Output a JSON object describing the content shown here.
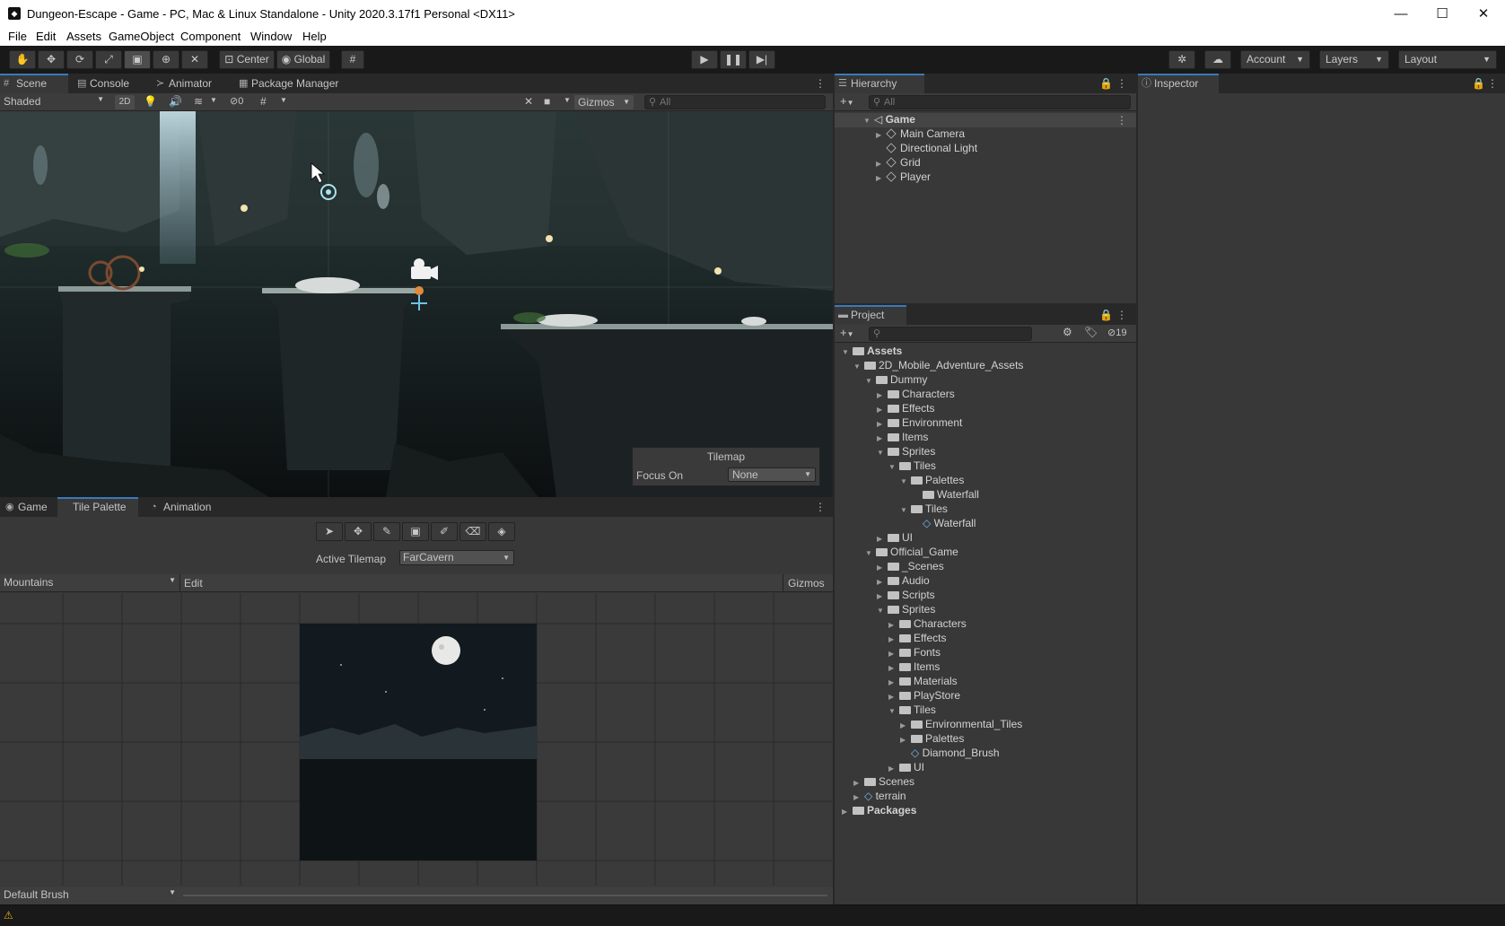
{
  "window": {
    "title": "Dungeon-Escape - Game - PC, Mac & Linux Standalone - Unity 2020.3.17f1 Personal <DX11>",
    "minimize": "—",
    "maximize": "☐",
    "close": "✕"
  },
  "menu": [
    "File",
    "Edit",
    "Assets",
    "GameObject",
    "Component",
    "Window",
    "Help"
  ],
  "toolbar": {
    "center_label": "Center",
    "global_label": "Global",
    "account_label": "Account",
    "layers_label": "Layers",
    "layout_label": "Layout"
  },
  "scene_panel": {
    "tabs": [
      "Scene",
      "Console",
      "Animator",
      "Package Manager"
    ],
    "shading_mode": "Shaded",
    "mode_2d": "2D",
    "hidden_count": "0",
    "gizmos_label": "Gizmos",
    "search_placeholder": "All",
    "tilemap_overlay": {
      "title": "Tilemap",
      "focus_label": "Focus On",
      "focus_value": "None"
    }
  },
  "palette_panel": {
    "tabs": [
      "Game",
      "Tile Palette",
      "Animation"
    ],
    "active_tilemap_label": "Active Tilemap",
    "active_tilemap_value": "FarCavern",
    "palette_name": "Mountains",
    "edit_label": "Edit",
    "gizmos_label": "Gizmos",
    "brush_label": "Default Brush"
  },
  "hierarchy": {
    "tab_label": "Hierarchy",
    "search_placeholder": "All",
    "scene_name": "Game",
    "items": [
      "Main Camera",
      "Directional Light",
      "Grid",
      "Player"
    ]
  },
  "inspector": {
    "tab_label": "Inspector"
  },
  "project": {
    "tab_label": "Project",
    "hidden_count": "19",
    "tree": [
      {
        "label": "Assets",
        "depth": 0,
        "expanded": true,
        "bold": true
      },
      {
        "label": "2D_Mobile_Adventure_Assets",
        "depth": 1,
        "expanded": true
      },
      {
        "label": "Dummy",
        "depth": 2,
        "expanded": true
      },
      {
        "label": "Characters",
        "depth": 3,
        "expanded": false
      },
      {
        "label": "Effects",
        "depth": 3,
        "expanded": false
      },
      {
        "label": "Environment",
        "depth": 3,
        "expanded": false
      },
      {
        "label": "Items",
        "depth": 3,
        "expanded": false
      },
      {
        "label": "Sprites",
        "depth": 3,
        "expanded": true
      },
      {
        "label": "Tiles",
        "depth": 4,
        "expanded": true
      },
      {
        "label": "Palettes",
        "depth": 5,
        "expanded": true
      },
      {
        "label": "Waterfall",
        "depth": 6,
        "leaf": true
      },
      {
        "label": "Tiles",
        "depth": 5,
        "expanded": true
      },
      {
        "label": "Waterfall",
        "depth": 6,
        "leaf": true,
        "tile": true
      },
      {
        "label": "UI",
        "depth": 3,
        "expanded": false
      },
      {
        "label": "Official_Game",
        "depth": 2,
        "expanded": true
      },
      {
        "label": "_Scenes",
        "depth": 3,
        "expanded": false
      },
      {
        "label": "Audio",
        "depth": 3,
        "expanded": false
      },
      {
        "label": "Scripts",
        "depth": 3,
        "expanded": false
      },
      {
        "label": "Sprites",
        "depth": 3,
        "expanded": true
      },
      {
        "label": "Characters",
        "depth": 4,
        "expanded": false
      },
      {
        "label": "Effects",
        "depth": 4,
        "expanded": false
      },
      {
        "label": "Fonts",
        "depth": 4,
        "expanded": false
      },
      {
        "label": "Items",
        "depth": 4,
        "expanded": false
      },
      {
        "label": "Materials",
        "depth": 4,
        "expanded": false
      },
      {
        "label": "PlayStore",
        "depth": 4,
        "expanded": false
      },
      {
        "label": "Tiles",
        "depth": 4,
        "expanded": true
      },
      {
        "label": "Environmental_Tiles",
        "depth": 5,
        "expanded": false
      },
      {
        "label": "Palettes",
        "depth": 5,
        "expanded": false
      },
      {
        "label": "Diamond_Brush",
        "depth": 5,
        "leaf": true,
        "tile": true
      },
      {
        "label": "UI",
        "depth": 4,
        "expanded": false
      },
      {
        "label": "Scenes",
        "depth": 1,
        "expanded": false
      },
      {
        "label": "terrain",
        "depth": 1,
        "expanded": false,
        "tile": true
      },
      {
        "label": "Packages",
        "depth": 0,
        "expanded": false,
        "bold": true
      }
    ]
  },
  "colors": {
    "accent": "#3a79bb",
    "panel": "#383838",
    "dark": "#191919"
  }
}
